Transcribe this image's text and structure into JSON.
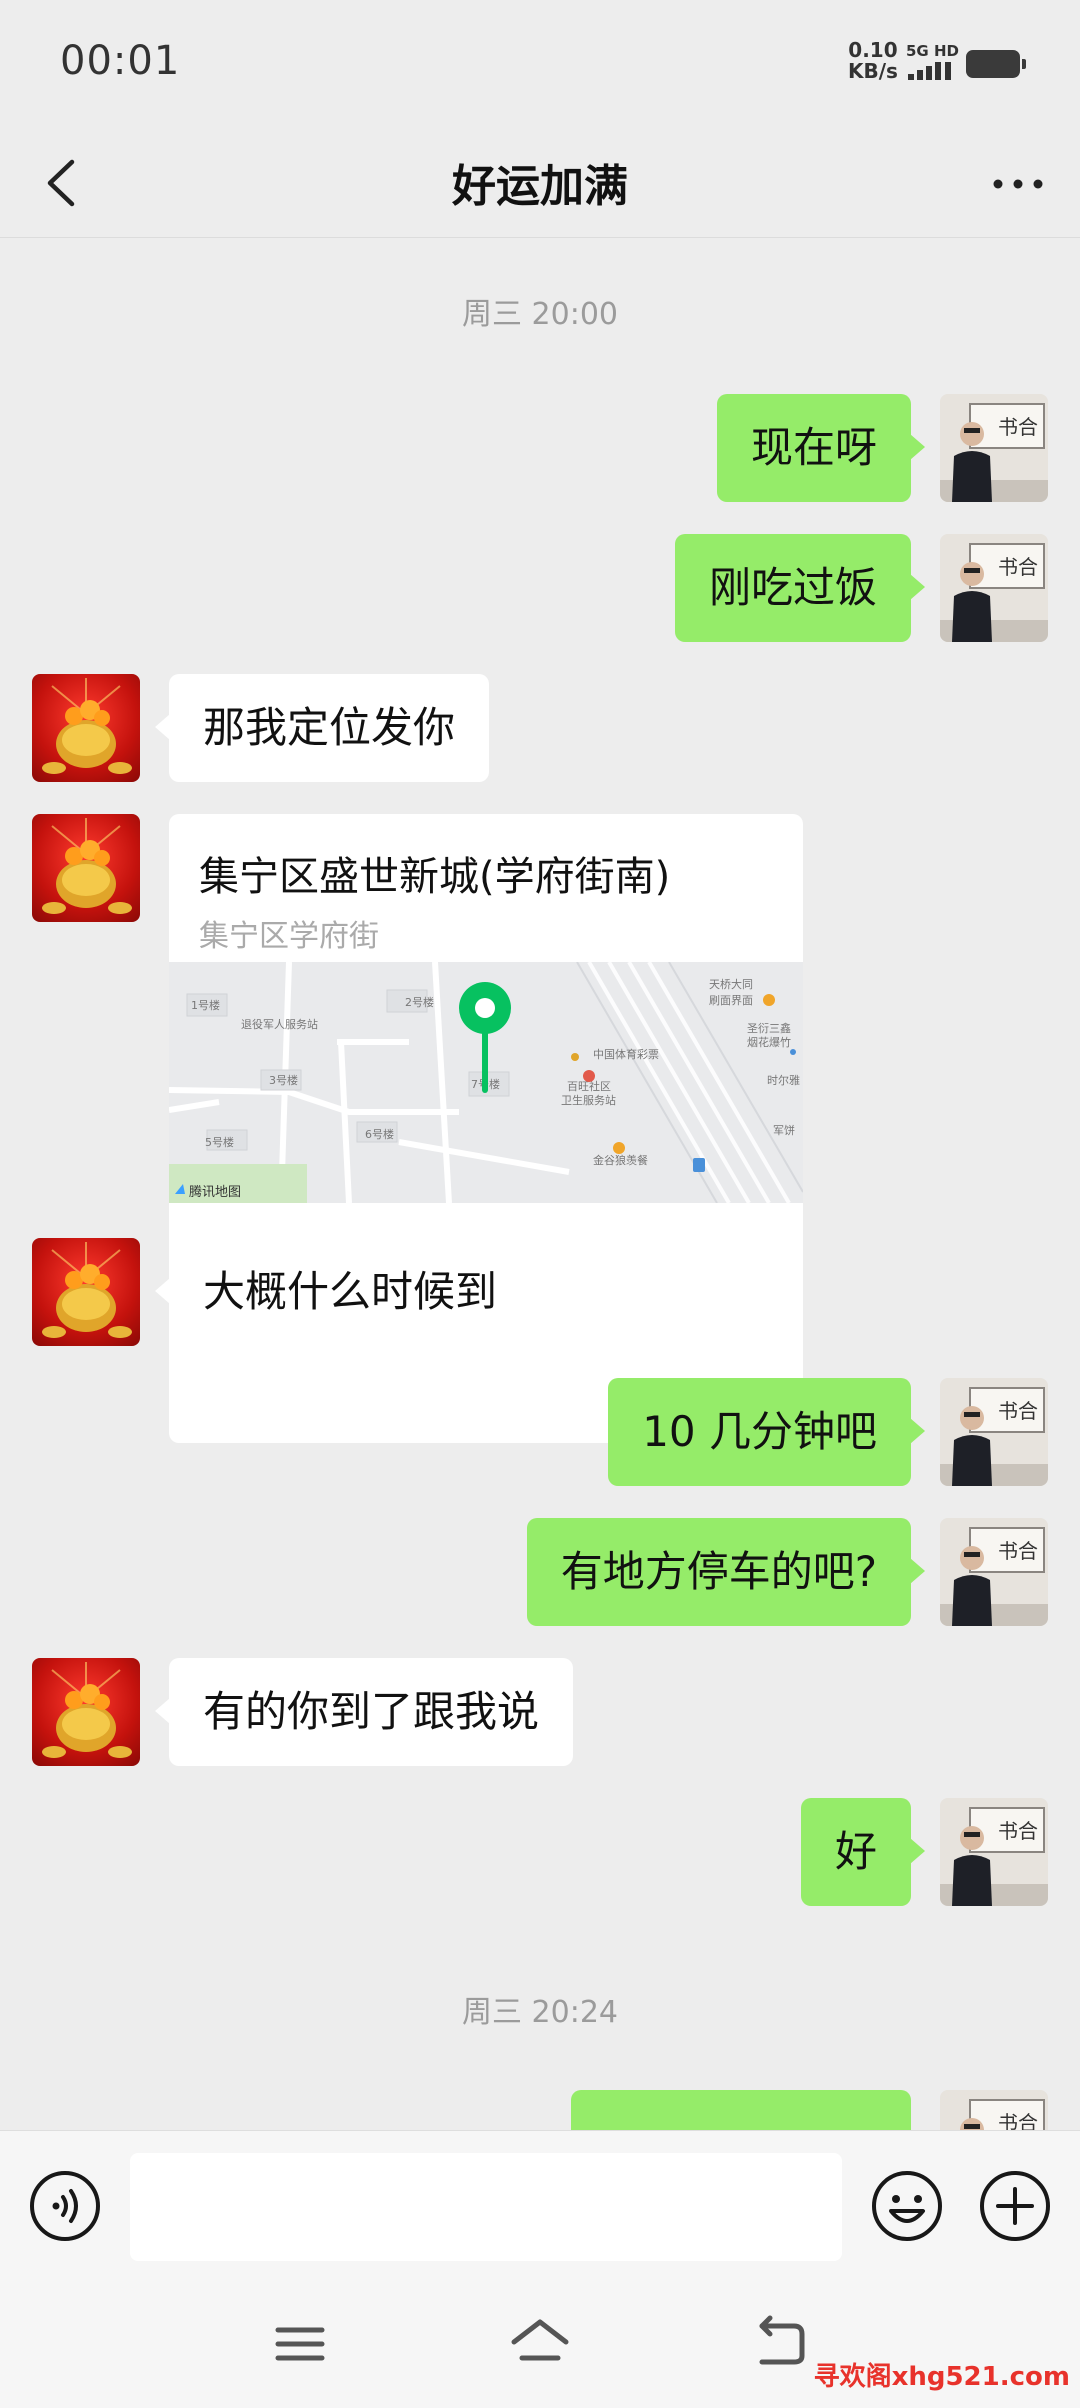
{
  "status_bar": {
    "time": "00:01",
    "net_speed_value": "0.10",
    "net_speed_unit": "KB/s",
    "network_type": "5G HD"
  },
  "header": {
    "title": "好运加满"
  },
  "messages": [
    {
      "type": "timestamp",
      "text": "周三 20:00"
    },
    {
      "type": "text",
      "side": "out",
      "text": "现在呀"
    },
    {
      "type": "text",
      "side": "out",
      "text": "刚吃过饭"
    },
    {
      "type": "text",
      "side": "in",
      "text": "那我定位发你"
    },
    {
      "type": "location",
      "side": "in",
      "name": "集宁区盛世新城(学府街南)",
      "address": "集宁区学府街",
      "map_labels": [
        "1号楼",
        "2号楼",
        "退役军人服务站",
        "3号楼",
        "7号楼",
        "6号楼",
        "5号楼",
        "中国体育彩票",
        "百旺社区",
        "卫生服务站",
        "金谷狼羡餐",
        "天桥大同",
        "刷面界面",
        "圣衍三鑫",
        "烟花爆竹",
        "时尔雅",
        "军饼"
      ],
      "map_brand": "腾讯地图"
    },
    {
      "type": "text",
      "side": "in",
      "text": "大概什么时候到"
    },
    {
      "type": "text",
      "side": "out",
      "text": "10 几分钟吧"
    },
    {
      "type": "text",
      "side": "out",
      "text": "有地方停车的吧?"
    },
    {
      "type": "text",
      "side": "in",
      "text": "有的你到了跟我说"
    },
    {
      "type": "text",
      "side": "out",
      "text": "好"
    },
    {
      "type": "timestamp",
      "text": "周三 20:24"
    }
  ],
  "input_bar": {
    "placeholder": "",
    "icons": [
      "voice-icon",
      "emoji-icon",
      "plus-icon"
    ]
  },
  "nav_bar": {
    "icons": [
      "menu-icon",
      "home-icon",
      "back-nav-icon"
    ]
  },
  "watermark": "寻欢阁xhg521.com",
  "colors": {
    "outgoing_bubble": "#95ec69",
    "incoming_bubble": "#ffffff",
    "background": "#ededed",
    "map_pin": "#07c160"
  }
}
